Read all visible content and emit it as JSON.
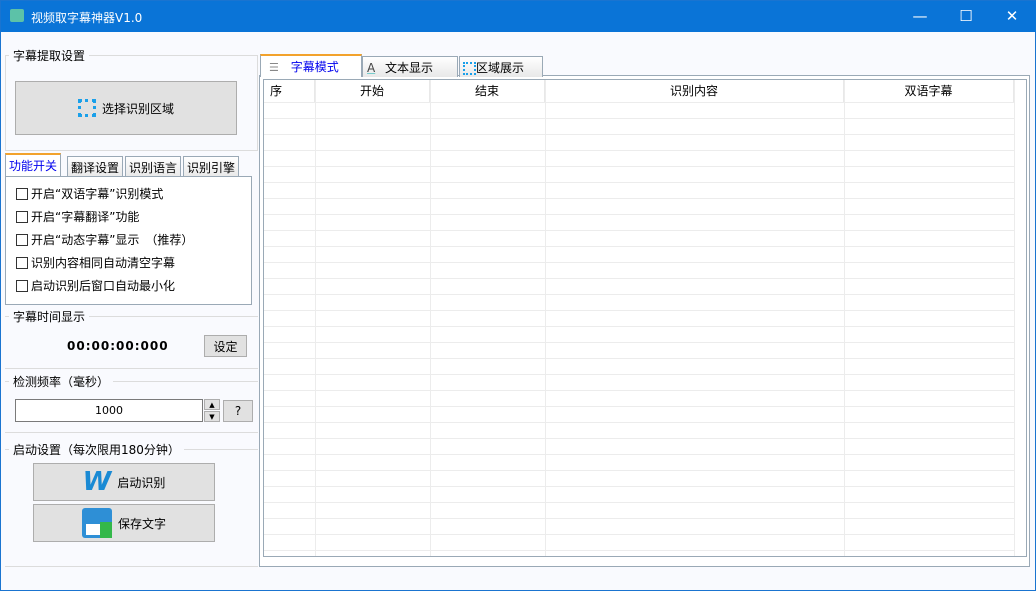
{
  "window": {
    "title": "视频取字幕神器V1.0"
  },
  "left": {
    "extract_group": "字幕提取设置",
    "select_area_button": "选择识别区域",
    "tabs": [
      "功能开关",
      "翻译设置",
      "识别语言",
      "识别引擎"
    ],
    "options": [
      {
        "label": "开启“双语字幕”识别模式",
        "checked": false
      },
      {
        "label": "开启“字幕翻译”功能",
        "checked": false
      },
      {
        "label": "开启“动态字幕”显示　（推荐）",
        "checked": false
      },
      {
        "label": "识别内容相同自动清空字幕",
        "checked": false
      },
      {
        "label": "启动识别后窗口自动最小化",
        "checked": false
      }
    ],
    "time_group": "字幕时间显示",
    "time_value": "00:00:00:000",
    "set_button": "设定",
    "freq_group": "检测频率（毫秒）",
    "freq_value": "1000",
    "help_button": "?",
    "start_group": "启动设置（每次限用180分钟）",
    "start_button": "启动识别",
    "save_button": "保存文字"
  },
  "right": {
    "tabs": [
      "字幕模式",
      "文本显示",
      "区域展示"
    ],
    "columns": [
      "序",
      "开始",
      "结束",
      "识别内容",
      "双语字幕"
    ],
    "rows": []
  }
}
